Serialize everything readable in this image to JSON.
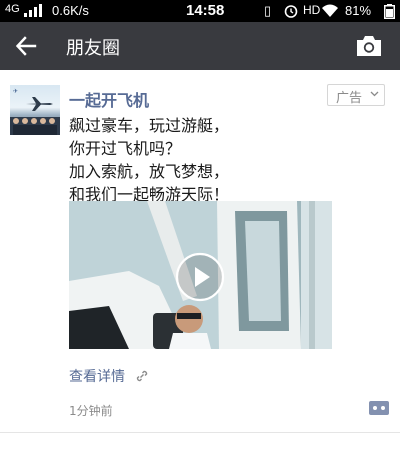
{
  "status_bar": {
    "network": "4G",
    "speed": "0.6K/s",
    "time": "14:58",
    "hd": "HD",
    "battery": "81%"
  },
  "nav": {
    "title": "朋友圈",
    "back_icon": "back-arrow-icon",
    "camera_icon": "camera-icon"
  },
  "post": {
    "author": "一起开飞机",
    "ad_label": "广告",
    "text_lines": [
      "飙过豪车，玩过游艇，",
      "你开过飞机吗？",
      "加入索航，放飞梦想，",
      "和我们一起畅游天际！"
    ],
    "detail_link": "查看详情",
    "time": "1分钟前"
  },
  "colors": {
    "nav_bg": "#393a3f",
    "link": "#576b95",
    "status_bg": "#000000"
  }
}
